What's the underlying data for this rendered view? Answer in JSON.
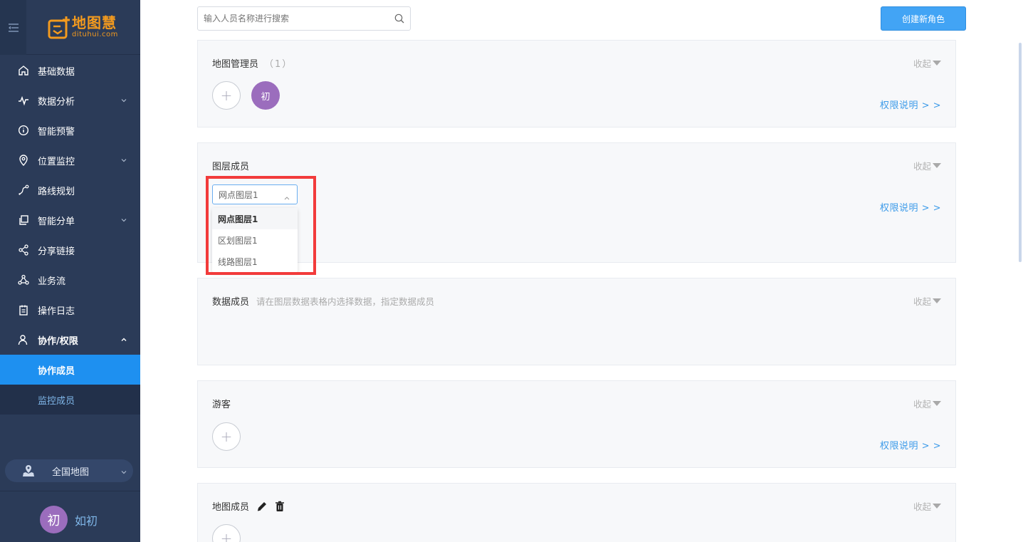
{
  "sidebar": {
    "logo_cn": "地图慧",
    "logo_en": "dituhui.com",
    "items": [
      {
        "label": "基础数据",
        "has_children": false
      },
      {
        "label": "数据分析",
        "has_children": true
      },
      {
        "label": "智能预警",
        "has_children": false
      },
      {
        "label": "位置监控",
        "has_children": true
      },
      {
        "label": "路线规划",
        "has_children": false
      },
      {
        "label": "智能分单",
        "has_children": true
      },
      {
        "label": "分享链接",
        "has_children": false
      },
      {
        "label": "业务流",
        "has_children": false
      },
      {
        "label": "操作日志",
        "has_children": false
      },
      {
        "label": "协作/权限",
        "has_children": true,
        "expanded": true
      }
    ],
    "subitems": [
      {
        "label": "协作成员",
        "active": true
      },
      {
        "label": "监控成员",
        "active": false
      }
    ],
    "map_selector": "全国地图",
    "user": {
      "avatar_char": "初",
      "name": "如初"
    }
  },
  "toolbar": {
    "search_placeholder": "输入人员名称进行搜索",
    "create_button": "创建新角色"
  },
  "cards": {
    "map_admin": {
      "title": "地图管理员",
      "count": "（1）",
      "collapse": "收起",
      "perm": "权限说明 > >",
      "member_char": "初"
    },
    "layer_members": {
      "title": "图层成员",
      "collapse": "收起",
      "perm": "权限说明 > >",
      "select_value": "网点图层1",
      "options": [
        "网点图层1",
        "区划图层1",
        "线路图层1"
      ]
    },
    "data_members": {
      "title": "数据成员",
      "hint": "请在图层数据表格内选择数据，指定数据成员",
      "collapse": "收起"
    },
    "guests": {
      "title": "游客",
      "collapse": "收起",
      "perm": "权限说明 > >"
    },
    "map_members": {
      "title": "地图成员",
      "collapse": "收起"
    }
  },
  "colors": {
    "sidebar_bg": "#2b3b58",
    "active_blue": "#1e90f0",
    "brand_orange": "#f39a1e",
    "avatar_purple": "#9b6dbd",
    "link_blue": "#3d9be9",
    "highlight_red": "#f23b3b"
  }
}
